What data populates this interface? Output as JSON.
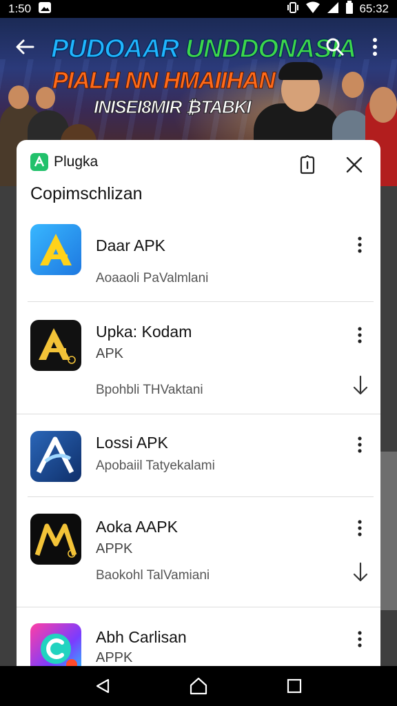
{
  "status_bar": {
    "time": "1:50",
    "clock": "65:32",
    "icons": [
      "photo-icon",
      "vibrate-icon",
      "wifi-icon",
      "signal-icon",
      "battery-icon"
    ]
  },
  "banner": {
    "title_line1_a": "PUDOAAR ",
    "title_line1_b": "UNDDONASIA",
    "title_line2": "PIALH NN HMAIIHAN",
    "title_line3": "INISEI8MIR ₿TABKI",
    "colors": {
      "line1": "#1fb6ff",
      "line1_accent": "#3cd84a",
      "line2": "#ff6a1a",
      "line3": "#ffffff"
    }
  },
  "sheet": {
    "brand": "Plugka",
    "title": "Copimschlizan",
    "accent": "#21c16b"
  },
  "apps": [
    {
      "name": "Daar APK",
      "type": "",
      "description": "Aoaaoli PaValmlani",
      "download": false,
      "icon": "app-icon-yellow-a"
    },
    {
      "name": "Upka: Kodam",
      "type": "APK",
      "description": "Bpohbli THVaktani",
      "download": true,
      "icon": "app-icon-gold-a-black"
    },
    {
      "name": "Lossi APK",
      "type": "",
      "description": "Apobaiil Tatyekalami",
      "download": false,
      "icon": "app-icon-blue-a"
    },
    {
      "name": "Aoka AAPK",
      "type": "APPK",
      "description": "Baokohl TalVamiani",
      "download": true,
      "icon": "app-icon-gold-m-black"
    },
    {
      "name": "Abh Carlisan",
      "type": "APPK",
      "description": "",
      "download": false,
      "icon": "app-icon-gradient-c"
    }
  ],
  "nav": [
    "back-icon",
    "home-icon",
    "recents-icon"
  ]
}
